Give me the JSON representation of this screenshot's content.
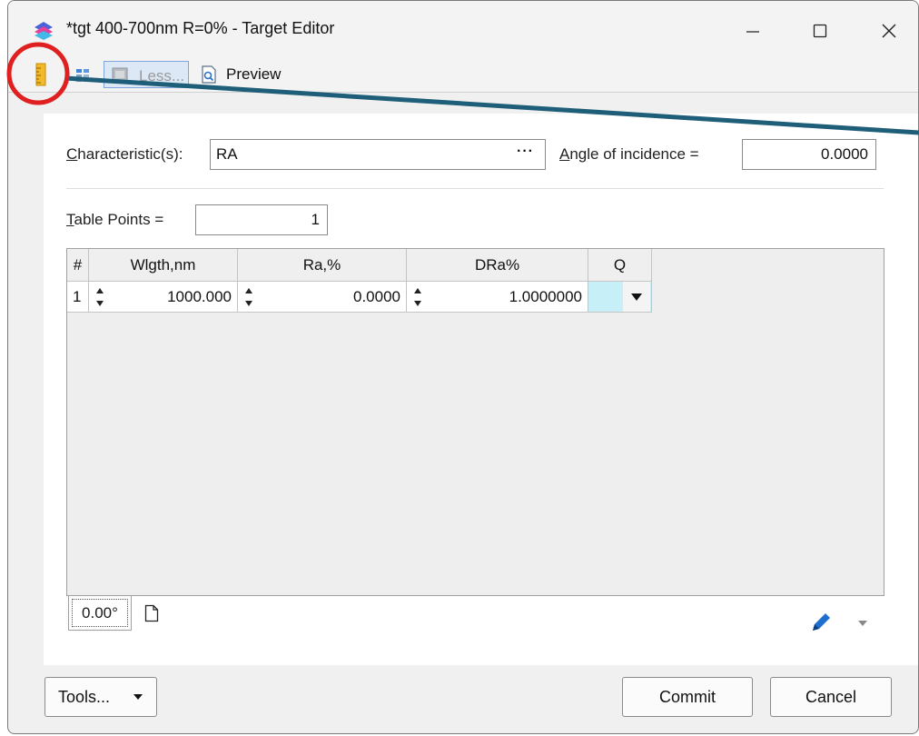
{
  "window": {
    "title": "*tgt 400-700nm R=0% - Target Editor",
    "controls": [
      "minimize",
      "maximize",
      "close"
    ]
  },
  "toolbar": {
    "less_label": "Less...",
    "preview_label": "Preview",
    "icons": [
      "ruler-icon",
      "grid-icon",
      "less-icon",
      "preview-icon"
    ]
  },
  "form": {
    "characteristics_label": "Characteristic(s):",
    "characteristics_label_ul": "C",
    "characteristics_label_rest": "haracteristic(s):",
    "characteristics_value": "RA",
    "characteristics_button": "···",
    "angle_label_ul": "A",
    "angle_label_rest": "ngle of incidence =",
    "angle_value": "0.0000",
    "points_label_ul": "T",
    "points_label_rest": "able Points =",
    "points_value": "1"
  },
  "table": {
    "headers": [
      "#",
      "Wlgth,nm",
      "Ra,%",
      "DRa%",
      "Q"
    ],
    "rows": [
      {
        "index": "1",
        "wavelength": "1000.000",
        "ra": "0.0000",
        "dra": "1.0000000",
        "q": ""
      }
    ]
  },
  "tabs": {
    "angle_tab": "0.00°"
  },
  "buttons": {
    "tools": "Tools...",
    "commit": "Commit",
    "cancel": "Cancel"
  },
  "annotation": {
    "highlight_color": "#e02020",
    "arrow_color": "#1f5e78",
    "highlighted_item": "ruler-icon"
  },
  "colors": {
    "accent": "#2a6fc9",
    "q_cell": "#c6eff7",
    "app_icon": [
      "#e8409a",
      "#4a63d8",
      "#43b9e8"
    ]
  }
}
